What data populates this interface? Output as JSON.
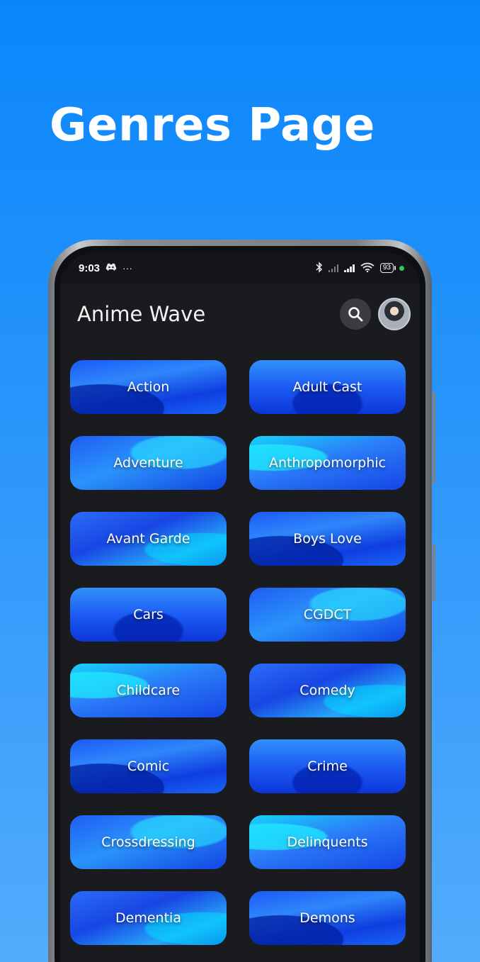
{
  "page_heading": "Genres Page",
  "status_bar": {
    "time": "9:03",
    "battery_level": "93"
  },
  "app_bar": {
    "title": "Anime Wave"
  },
  "genres": [
    "Action",
    "Adult Cast",
    "Adventure",
    "Anthropomorphic",
    "Avant Garde",
    "Boys Love",
    "Cars",
    "CGDCT",
    "Childcare",
    "Comedy",
    "Comic",
    "Crime",
    "Crossdressing",
    "Delinquents",
    "Dementia",
    "Demons"
  ],
  "colors": {
    "background_top": "#0a86fb",
    "background_bottom": "#52acfc",
    "screen_bg": "#1a1b1f",
    "card_blue": "#1c5af6",
    "card_cyan": "#16d3fb"
  }
}
